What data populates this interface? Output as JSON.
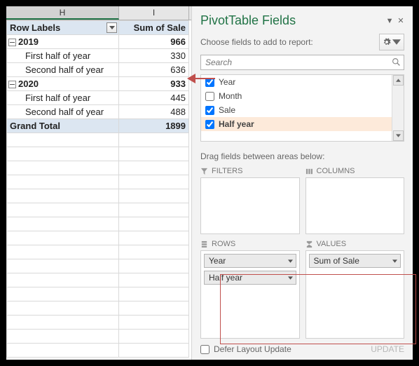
{
  "columns": {
    "H": "H",
    "I": "I"
  },
  "pivot": {
    "row_labels_header": "Row Labels",
    "sum_header": "Sum of Sale",
    "rows": [
      {
        "type": "group",
        "label": "2019",
        "value": 966
      },
      {
        "type": "detail",
        "label": "First half of year",
        "value": 330
      },
      {
        "type": "detail",
        "label": "Second half of year",
        "value": 636
      },
      {
        "type": "group",
        "label": "2020",
        "value": 933
      },
      {
        "type": "detail",
        "label": "First half of year",
        "value": 445
      },
      {
        "type": "detail",
        "label": "Second half of year",
        "value": 488
      }
    ],
    "grand_total_label": "Grand Total",
    "grand_total_value": 1899
  },
  "pane": {
    "title": "PivotTable Fields",
    "choose_text": "Choose fields to add to report:",
    "search_placeholder": "Search",
    "fields": [
      {
        "name": "Year",
        "checked": true,
        "bold": false
      },
      {
        "name": "Month",
        "checked": false,
        "bold": false
      },
      {
        "name": "Sale",
        "checked": true,
        "bold": false
      },
      {
        "name": "Half year",
        "checked": true,
        "bold": true
      }
    ],
    "drag_hint": "Drag fields between areas below:",
    "areas": {
      "filters": {
        "title": "FILTERS",
        "items": []
      },
      "columns": {
        "title": "COLUMNS",
        "items": []
      },
      "rows": {
        "title": "ROWS",
        "items": [
          "Year",
          "Half year"
        ]
      },
      "values": {
        "title": "VALUES",
        "items": [
          "Sum of Sale"
        ]
      }
    },
    "defer_label": "Defer Layout Update",
    "update_label": "UPDATE"
  }
}
